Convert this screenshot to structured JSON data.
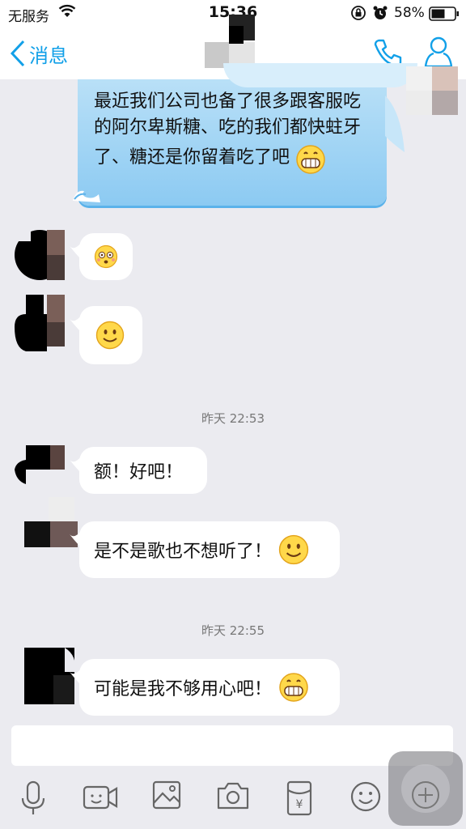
{
  "status_bar": {
    "carrier": "无服务",
    "time": "15:36",
    "battery": "58%"
  },
  "nav": {
    "back_label": "消息"
  },
  "messages": {
    "self_1": "最近我们公司也备了很多跟客服吃的阿尔卑斯糖、吃的我们都快蛀牙了、糖还是你留着吃了吧",
    "other_3": "额！好吧！",
    "other_4": "是不是歌也不想听了！",
    "other_5": "可能是我不够用心吧！"
  },
  "timestamps": {
    "t1": "昨天 22:53",
    "t2": "昨天 22:55"
  },
  "toolbar_icons": [
    "mic-icon",
    "video-icon",
    "image-icon",
    "camera-icon",
    "red-packet-icon",
    "emoji-icon",
    "plus-icon"
  ],
  "colors": {
    "accent": "#12a0e8",
    "self_bubble": "#a8d8f5",
    "background": "#ebebf0"
  }
}
